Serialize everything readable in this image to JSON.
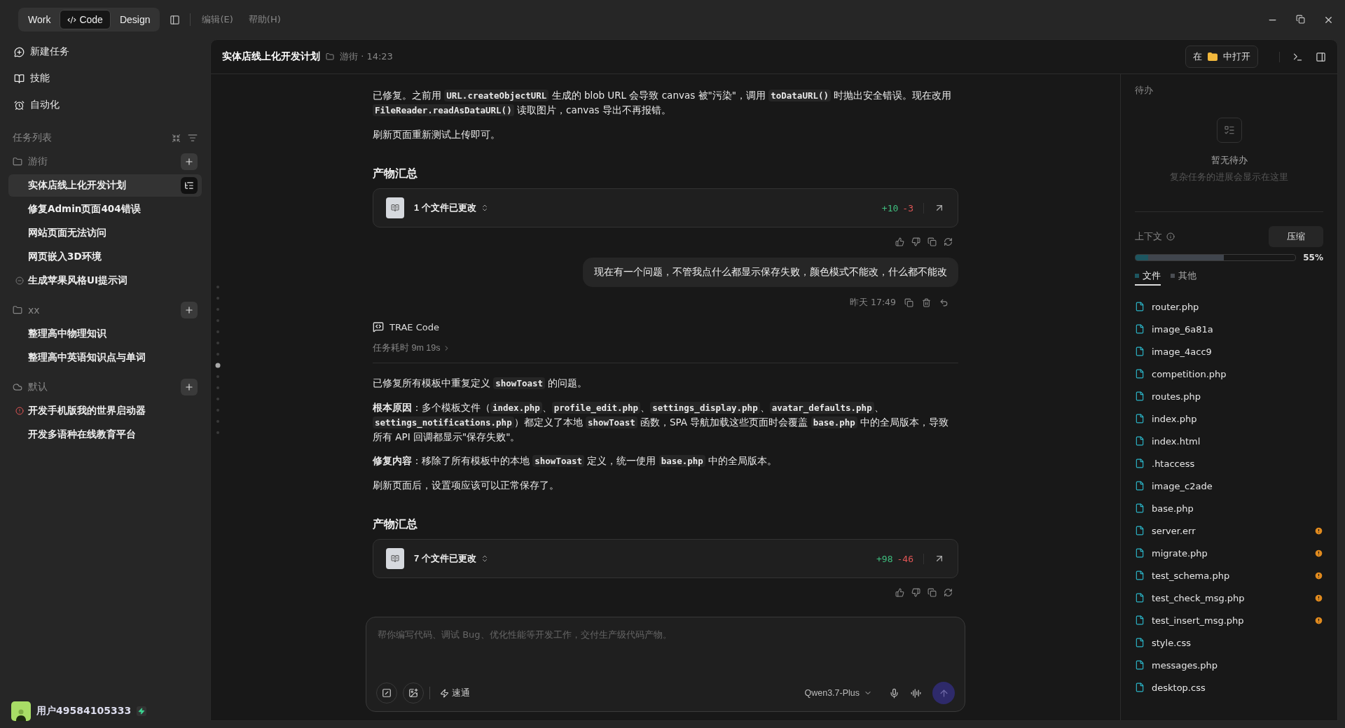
{
  "titlebar": {
    "modes": [
      {
        "label": "Work",
        "selected": false,
        "kind": "plain"
      },
      {
        "label": "Code",
        "selected": true,
        "kind": "code"
      },
      {
        "label": "Design",
        "selected": false,
        "kind": "plain"
      }
    ],
    "menus": [
      "编辑(E)",
      "帮助(H)"
    ]
  },
  "sidebar": {
    "nav": [
      {
        "label": "新建任务",
        "kind": "new"
      },
      {
        "label": "技能",
        "kind": "skills"
      },
      {
        "label": "自动化",
        "kind": "automation"
      }
    ],
    "list_title": "任务列表",
    "groups": [
      {
        "name": "游街",
        "kind": "folder",
        "tasks": [
          {
            "title": "实体店线上化开发计划",
            "selected": true,
            "kind": "plain"
          },
          {
            "title": "修复Admin页面404错误",
            "selected": false,
            "kind": "plain"
          },
          {
            "title": "网站页面无法访问",
            "selected": false,
            "kind": "plain"
          },
          {
            "title": "网页嵌入3D环境",
            "selected": false,
            "kind": "plain"
          },
          {
            "title": "生成苹果风格UI提示词",
            "selected": false,
            "kind": "stopped"
          }
        ]
      },
      {
        "name": "xx",
        "kind": "folder",
        "tasks": [
          {
            "title": "整理高中物理知识",
            "selected": false,
            "kind": "plain"
          },
          {
            "title": "整理高中英语知识点与单词",
            "selected": false,
            "kind": "plain"
          }
        ]
      },
      {
        "name": "默认",
        "kind": "cloud",
        "tasks": [
          {
            "title": "开发手机版我的世界启动器",
            "selected": false,
            "kind": "error"
          },
          {
            "title": "开发多语种在线教育平台",
            "selected": false,
            "kind": "plain"
          }
        ]
      }
    ],
    "user": "用户49584105333"
  },
  "header": {
    "title": "实体店线上化开发计划",
    "meta": "游街 · 14:23",
    "open_in": [
      "在",
      "中打开"
    ]
  },
  "chat": [
    {
      "kind": "para",
      "segments": [
        {
          "kind": "text",
          "text": "已修复。之前用 "
        },
        {
          "kind": "code",
          "text": "URL.createObjectURL"
        },
        {
          "kind": "text",
          "text": " 生成的 blob URL 会导致 canvas 被\"污染\"，调用 "
        },
        {
          "kind": "code",
          "text": "toDataURL()"
        },
        {
          "kind": "text",
          "text": " 时抛出安全错误。现在改用 "
        },
        {
          "kind": "code",
          "text": "FileReader.readAsDataURL()"
        },
        {
          "kind": "text",
          "text": " 读取图片，canvas 导出不再报错。"
        }
      ]
    },
    {
      "kind": "para",
      "segments": [
        {
          "kind": "text",
          "text": "刷新页面重新测试上传即可。"
        }
      ]
    },
    {
      "kind": "heading",
      "text": "产物汇总"
    },
    {
      "kind": "files",
      "text": "1 个文件已更改",
      "added": "+10",
      "removed": "-3"
    },
    {
      "kind": "actions"
    },
    {
      "kind": "user",
      "text": "现在有一个问题，不管我点什么都显示保存失败，颜色模式不能改，什么都不能改",
      "time": "昨天 17:49"
    },
    {
      "kind": "agent",
      "name": "TRAE Code",
      "duration": "任务耗时 9m 19s"
    },
    {
      "kind": "para",
      "segments": [
        {
          "kind": "text",
          "text": "已修复所有模板中重复定义 "
        },
        {
          "kind": "code",
          "text": "showToast"
        },
        {
          "kind": "text",
          "text": " 的问题。"
        }
      ]
    },
    {
      "kind": "para",
      "segments": [
        {
          "kind": "text",
          "text": "**根本原因**：多个模板文件（"
        },
        {
          "kind": "code",
          "text": "index.php"
        },
        {
          "kind": "text",
          "text": "、"
        },
        {
          "kind": "code",
          "text": "profile_edit.php"
        },
        {
          "kind": "text",
          "text": "、"
        },
        {
          "kind": "code",
          "text": "settings_display.php"
        },
        {
          "kind": "text",
          "text": "、"
        },
        {
          "kind": "code",
          "text": "avatar_defaults.php"
        },
        {
          "kind": "text",
          "text": "、"
        },
        {
          "kind": "code",
          "text": "settings_notifications.php"
        },
        {
          "kind": "text",
          "text": "）都定义了本地 "
        },
        {
          "kind": "code",
          "text": "showToast"
        },
        {
          "kind": "text",
          "text": " 函数，SPA 导航加载这些页面时会覆盖 "
        },
        {
          "kind": "code",
          "text": "base.php"
        },
        {
          "kind": "text",
          "text": " 中的全局版本，导致所有 API 回调都显示\"保存失败\"。"
        }
      ]
    },
    {
      "kind": "para",
      "segments": [
        {
          "kind": "text",
          "text": "**修复内容**：移除了所有模板中的本地 "
        },
        {
          "kind": "code",
          "text": "showToast"
        },
        {
          "kind": "text",
          "text": " 定义，统一使用 "
        },
        {
          "kind": "code",
          "text": "base.php"
        },
        {
          "kind": "text",
          "text": " 中的全局版本。"
        }
      ]
    },
    {
      "kind": "para",
      "segments": [
        {
          "kind": "text",
          "text": "刷新页面后，设置项应该可以正常保存了。"
        }
      ]
    },
    {
      "kind": "heading",
      "text": "产物汇总"
    },
    {
      "kind": "files",
      "text": "7 个文件已更改",
      "added": "+98",
      "removed": "-46"
    },
    {
      "kind": "actions"
    }
  ],
  "composer": {
    "placeholder": "帮你编写代码、调试 Bug、优化性能等开发工作，交付生产级代码产物。",
    "mode": "速通",
    "model": "Qwen3.7-Plus"
  },
  "todo": {
    "title": "待办",
    "empty_title": "暂无待办",
    "empty_hint": "复杂任务的进展会显示在这里"
  },
  "context": {
    "title": "上下文",
    "compress": "压缩",
    "reading": "55%",
    "segments": [
      {
        "level": 0.08,
        "color": "#1d5660"
      },
      {
        "level": 0.55,
        "color": "#40454d"
      }
    ],
    "tabs": [
      {
        "label": "文件",
        "color": "#1d5660",
        "selected": true
      },
      {
        "label": "其他",
        "color": "#4a4d52",
        "selected": false
      }
    ],
    "files": [
      {
        "name": "router.php",
        "warning": false
      },
      {
        "name": "image_6a81a",
        "warning": false
      },
      {
        "name": "image_4acc9",
        "warning": false
      },
      {
        "name": "competition.php",
        "warning": false
      },
      {
        "name": "routes.php",
        "warning": false
      },
      {
        "name": "index.php",
        "warning": false
      },
      {
        "name": "index.html",
        "warning": false
      },
      {
        "name": ".htaccess",
        "warning": false
      },
      {
        "name": "image_c2ade",
        "warning": false
      },
      {
        "name": "base.php",
        "warning": false
      },
      {
        "name": "server.err",
        "warning": true
      },
      {
        "name": "migrate.php",
        "warning": true
      },
      {
        "name": "test_schema.php",
        "warning": true
      },
      {
        "name": "test_check_msg.php",
        "warning": true
      },
      {
        "name": "test_insert_msg.php",
        "warning": true
      },
      {
        "name": "style.css",
        "warning": false
      },
      {
        "name": "messages.php",
        "warning": false
      },
      {
        "name": "desktop.css",
        "warning": false
      }
    ]
  }
}
